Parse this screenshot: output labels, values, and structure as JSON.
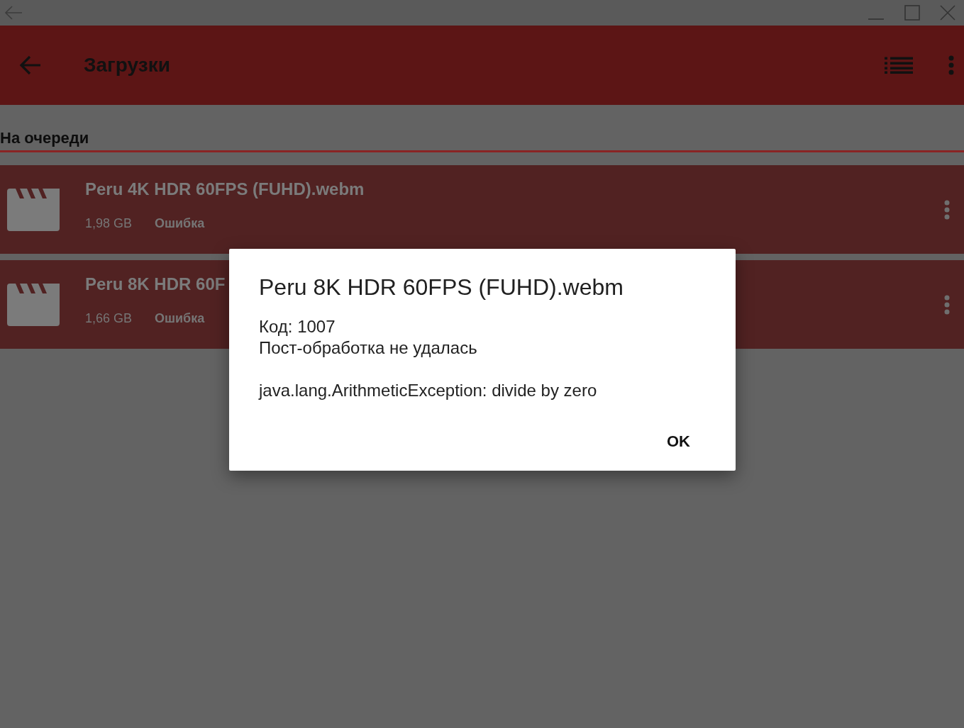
{
  "app_bar": {
    "title": "Загрузки"
  },
  "section": {
    "title": "На очереди"
  },
  "downloads": [
    {
      "name": "Peru 4K HDR 60FPS (FUHD).webm",
      "size": "1,98 GB",
      "status": "Ошибка"
    },
    {
      "name": "Peru 8K HDR 60F",
      "size": "1,66 GB",
      "status": "Ошибка"
    }
  ],
  "dialog": {
    "title": "Peru 8K HDR 60FPS (FUHD).webm",
    "code": "Код: 1007",
    "message": "Пост-обработка не удалась",
    "detail": "java.lang.ArithmeticException: divide by zero",
    "button": "OK"
  }
}
